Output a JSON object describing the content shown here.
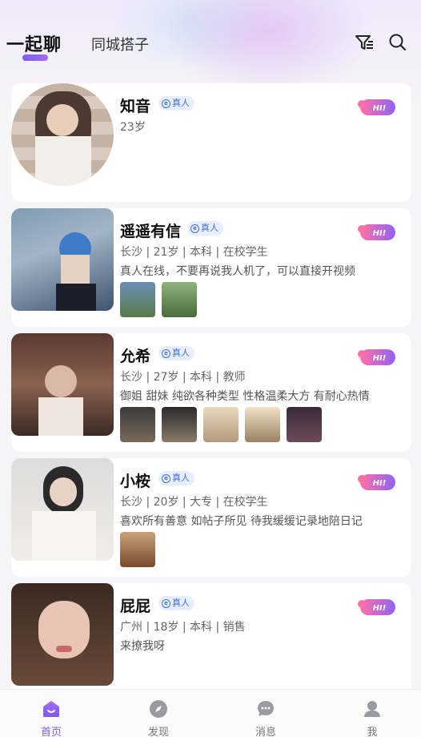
{
  "header": {
    "tab_active": "一起聊",
    "tab_inactive": "同城搭子"
  },
  "badge_label": "真人",
  "profiles": [
    {
      "name": "知音",
      "info": "23岁",
      "intro": "",
      "thumb_count": 0
    },
    {
      "name": "遥遥有信",
      "info": "长沙 | 21岁 | 本科 | 在校学生",
      "intro": "真人在线，不要再说我人机了，可以直接开视频",
      "thumb_count": 2
    },
    {
      "name": "允希",
      "info": "长沙 | 27岁 | 本科 | 教师",
      "intro": "御姐 甜妹 纯欲各种类型 性格温柔大方 有耐心热情",
      "thumb_count": 5
    },
    {
      "name": "小桉",
      "info": "长沙 | 20岁 | 大专 | 在校学生",
      "intro": "喜欢所有善意 如帖子所见 待我缓缓记录地陪日记",
      "thumb_count": 1
    },
    {
      "name": "屁屁",
      "info": "广州 | 18岁 | 本科 | 销售",
      "intro": "来撩我呀",
      "thumb_count": 0
    }
  ],
  "hi_label": "HI!",
  "nav": [
    {
      "label": "首页",
      "icon": "home-icon",
      "active": true
    },
    {
      "label": "发现",
      "icon": "compass-icon",
      "active": false
    },
    {
      "label": "消息",
      "icon": "chat-icon",
      "active": false
    },
    {
      "label": "我",
      "icon": "person-icon",
      "active": false
    }
  ],
  "colors": {
    "accent": "#7b5cf0",
    "hi_gradient_start": "#8f63f2",
    "hi_gradient_end": "#ff6fa8",
    "badge_bg": "#e8eefc",
    "badge_text": "#3f6fe0"
  }
}
